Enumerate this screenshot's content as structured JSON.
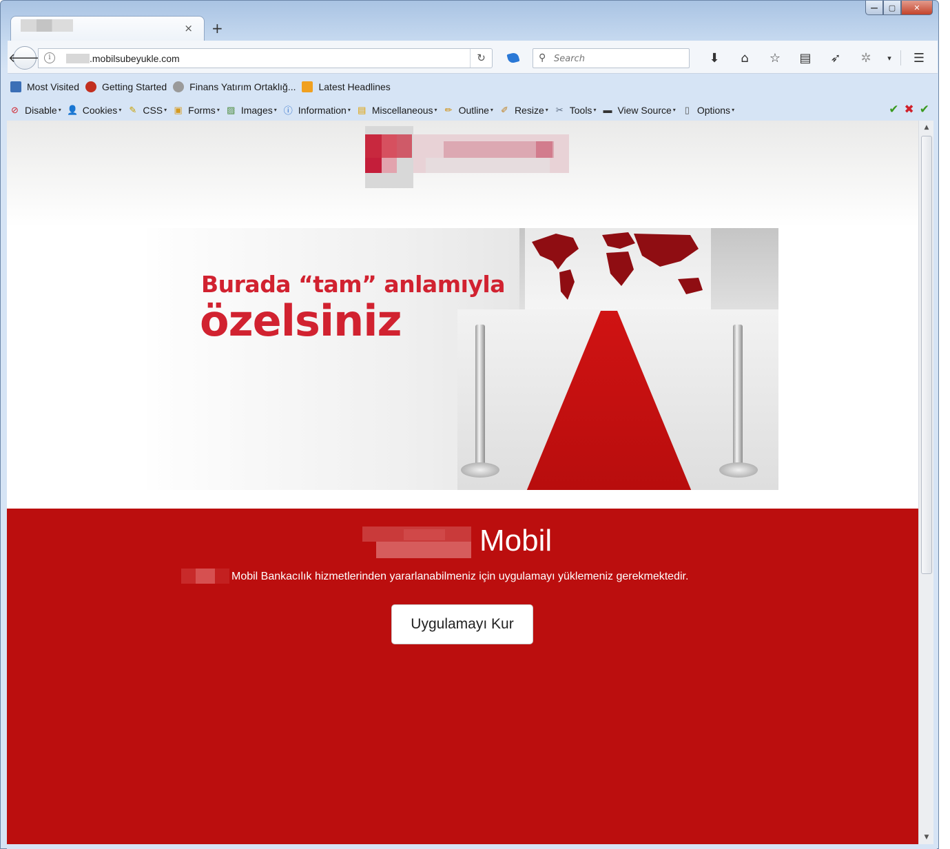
{
  "browser": {
    "tab": {
      "close_glyph": "×"
    },
    "new_tab_glyph": "+",
    "window_controls": {
      "minimize": "—",
      "maximize": "▢",
      "close": "✕"
    },
    "url": ".mobilsubeyukle.com",
    "search_placeholder": "Search",
    "nav_icons": [
      "download-icon",
      "home-icon",
      "bookmark-star-icon",
      "reading-list-icon",
      "send-icon",
      "extension-icon",
      "menu-icon"
    ]
  },
  "bookmarks": [
    {
      "label": "Most Visited",
      "icon": "most-visited-icon",
      "color": "#3b6fb6"
    },
    {
      "label": "Getting Started",
      "icon": "firefox-icon",
      "color": "#c22f1f"
    },
    {
      "label": "Finans Yatırım Ortaklığ...",
      "icon": "globe-icon",
      "color": "#9a9a9a"
    },
    {
      "label": "Latest Headlines",
      "icon": "rss-icon",
      "color": "#f0a020"
    }
  ],
  "devtoolbar": [
    {
      "label": "Disable",
      "icon": "disable-icon"
    },
    {
      "label": "Cookies",
      "icon": "cookies-icon"
    },
    {
      "label": "CSS",
      "icon": "css-icon"
    },
    {
      "label": "Forms",
      "icon": "forms-icon"
    },
    {
      "label": "Images",
      "icon": "images-icon"
    },
    {
      "label": "Information",
      "icon": "information-icon"
    },
    {
      "label": "Miscellaneous",
      "icon": "miscellaneous-icon"
    },
    {
      "label": "Outline",
      "icon": "outline-icon"
    },
    {
      "label": "Resize",
      "icon": "resize-icon"
    },
    {
      "label": "Tools",
      "icon": "tools-icon"
    },
    {
      "label": "View Source",
      "icon": "view-source-icon"
    },
    {
      "label": "Options",
      "icon": "options-icon"
    }
  ],
  "page": {
    "banner": {
      "headline_line1": "Burada “tam” anlamıyla",
      "headline_line2": "özelsiniz"
    },
    "section": {
      "title": "Mobil",
      "info": "Mobil Bankacılık hizmetlerinden yararlanabilmeniz için uygulamayı yüklemeniz gerekmektedir.",
      "install_button": "Uygulamayı Kur"
    }
  },
  "colors": {
    "brand_red": "#bb0e0e",
    "headline_red": "#d12230",
    "carpet_red": "#c81010"
  }
}
